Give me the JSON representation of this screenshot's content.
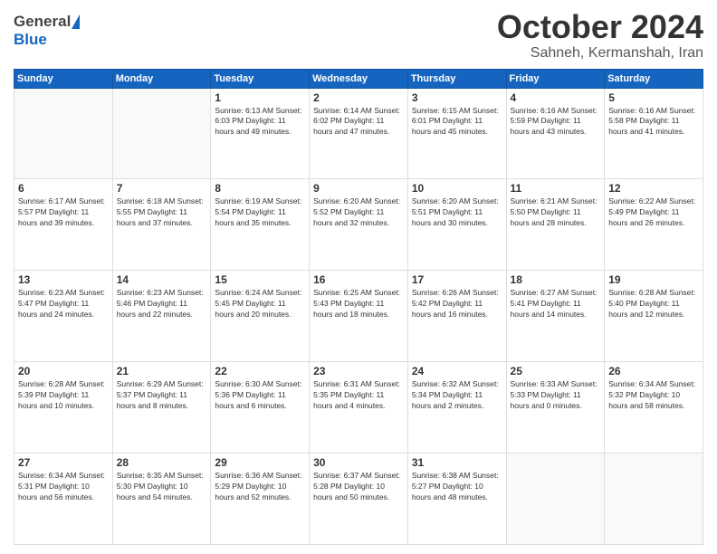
{
  "header": {
    "logo_general": "General",
    "logo_blue": "Blue",
    "month_title": "October 2024",
    "subtitle": "Sahneh, Kermanshah, Iran"
  },
  "weekdays": [
    "Sunday",
    "Monday",
    "Tuesday",
    "Wednesday",
    "Thursday",
    "Friday",
    "Saturday"
  ],
  "weeks": [
    [
      {
        "day": "",
        "info": ""
      },
      {
        "day": "",
        "info": ""
      },
      {
        "day": "1",
        "info": "Sunrise: 6:13 AM\nSunset: 6:03 PM\nDaylight: 11 hours and 49 minutes."
      },
      {
        "day": "2",
        "info": "Sunrise: 6:14 AM\nSunset: 6:02 PM\nDaylight: 11 hours and 47 minutes."
      },
      {
        "day": "3",
        "info": "Sunrise: 6:15 AM\nSunset: 6:01 PM\nDaylight: 11 hours and 45 minutes."
      },
      {
        "day": "4",
        "info": "Sunrise: 6:16 AM\nSunset: 5:59 PM\nDaylight: 11 hours and 43 minutes."
      },
      {
        "day": "5",
        "info": "Sunrise: 6:16 AM\nSunset: 5:58 PM\nDaylight: 11 hours and 41 minutes."
      }
    ],
    [
      {
        "day": "6",
        "info": "Sunrise: 6:17 AM\nSunset: 5:57 PM\nDaylight: 11 hours and 39 minutes."
      },
      {
        "day": "7",
        "info": "Sunrise: 6:18 AM\nSunset: 5:55 PM\nDaylight: 11 hours and 37 minutes."
      },
      {
        "day": "8",
        "info": "Sunrise: 6:19 AM\nSunset: 5:54 PM\nDaylight: 11 hours and 35 minutes."
      },
      {
        "day": "9",
        "info": "Sunrise: 6:20 AM\nSunset: 5:52 PM\nDaylight: 11 hours and 32 minutes."
      },
      {
        "day": "10",
        "info": "Sunrise: 6:20 AM\nSunset: 5:51 PM\nDaylight: 11 hours and 30 minutes."
      },
      {
        "day": "11",
        "info": "Sunrise: 6:21 AM\nSunset: 5:50 PM\nDaylight: 11 hours and 28 minutes."
      },
      {
        "day": "12",
        "info": "Sunrise: 6:22 AM\nSunset: 5:49 PM\nDaylight: 11 hours and 26 minutes."
      }
    ],
    [
      {
        "day": "13",
        "info": "Sunrise: 6:23 AM\nSunset: 5:47 PM\nDaylight: 11 hours and 24 minutes."
      },
      {
        "day": "14",
        "info": "Sunrise: 6:23 AM\nSunset: 5:46 PM\nDaylight: 11 hours and 22 minutes."
      },
      {
        "day": "15",
        "info": "Sunrise: 6:24 AM\nSunset: 5:45 PM\nDaylight: 11 hours and 20 minutes."
      },
      {
        "day": "16",
        "info": "Sunrise: 6:25 AM\nSunset: 5:43 PM\nDaylight: 11 hours and 18 minutes."
      },
      {
        "day": "17",
        "info": "Sunrise: 6:26 AM\nSunset: 5:42 PM\nDaylight: 11 hours and 16 minutes."
      },
      {
        "day": "18",
        "info": "Sunrise: 6:27 AM\nSunset: 5:41 PM\nDaylight: 11 hours and 14 minutes."
      },
      {
        "day": "19",
        "info": "Sunrise: 6:28 AM\nSunset: 5:40 PM\nDaylight: 11 hours and 12 minutes."
      }
    ],
    [
      {
        "day": "20",
        "info": "Sunrise: 6:28 AM\nSunset: 5:39 PM\nDaylight: 11 hours and 10 minutes."
      },
      {
        "day": "21",
        "info": "Sunrise: 6:29 AM\nSunset: 5:37 PM\nDaylight: 11 hours and 8 minutes."
      },
      {
        "day": "22",
        "info": "Sunrise: 6:30 AM\nSunset: 5:36 PM\nDaylight: 11 hours and 6 minutes."
      },
      {
        "day": "23",
        "info": "Sunrise: 6:31 AM\nSunset: 5:35 PM\nDaylight: 11 hours and 4 minutes."
      },
      {
        "day": "24",
        "info": "Sunrise: 6:32 AM\nSunset: 5:34 PM\nDaylight: 11 hours and 2 minutes."
      },
      {
        "day": "25",
        "info": "Sunrise: 6:33 AM\nSunset: 5:33 PM\nDaylight: 11 hours and 0 minutes."
      },
      {
        "day": "26",
        "info": "Sunrise: 6:34 AM\nSunset: 5:32 PM\nDaylight: 10 hours and 58 minutes."
      }
    ],
    [
      {
        "day": "27",
        "info": "Sunrise: 6:34 AM\nSunset: 5:31 PM\nDaylight: 10 hours and 56 minutes."
      },
      {
        "day": "28",
        "info": "Sunrise: 6:35 AM\nSunset: 5:30 PM\nDaylight: 10 hours and 54 minutes."
      },
      {
        "day": "29",
        "info": "Sunrise: 6:36 AM\nSunset: 5:29 PM\nDaylight: 10 hours and 52 minutes."
      },
      {
        "day": "30",
        "info": "Sunrise: 6:37 AM\nSunset: 5:28 PM\nDaylight: 10 hours and 50 minutes."
      },
      {
        "day": "31",
        "info": "Sunrise: 6:38 AM\nSunset: 5:27 PM\nDaylight: 10 hours and 48 minutes."
      },
      {
        "day": "",
        "info": ""
      },
      {
        "day": "",
        "info": ""
      }
    ]
  ]
}
